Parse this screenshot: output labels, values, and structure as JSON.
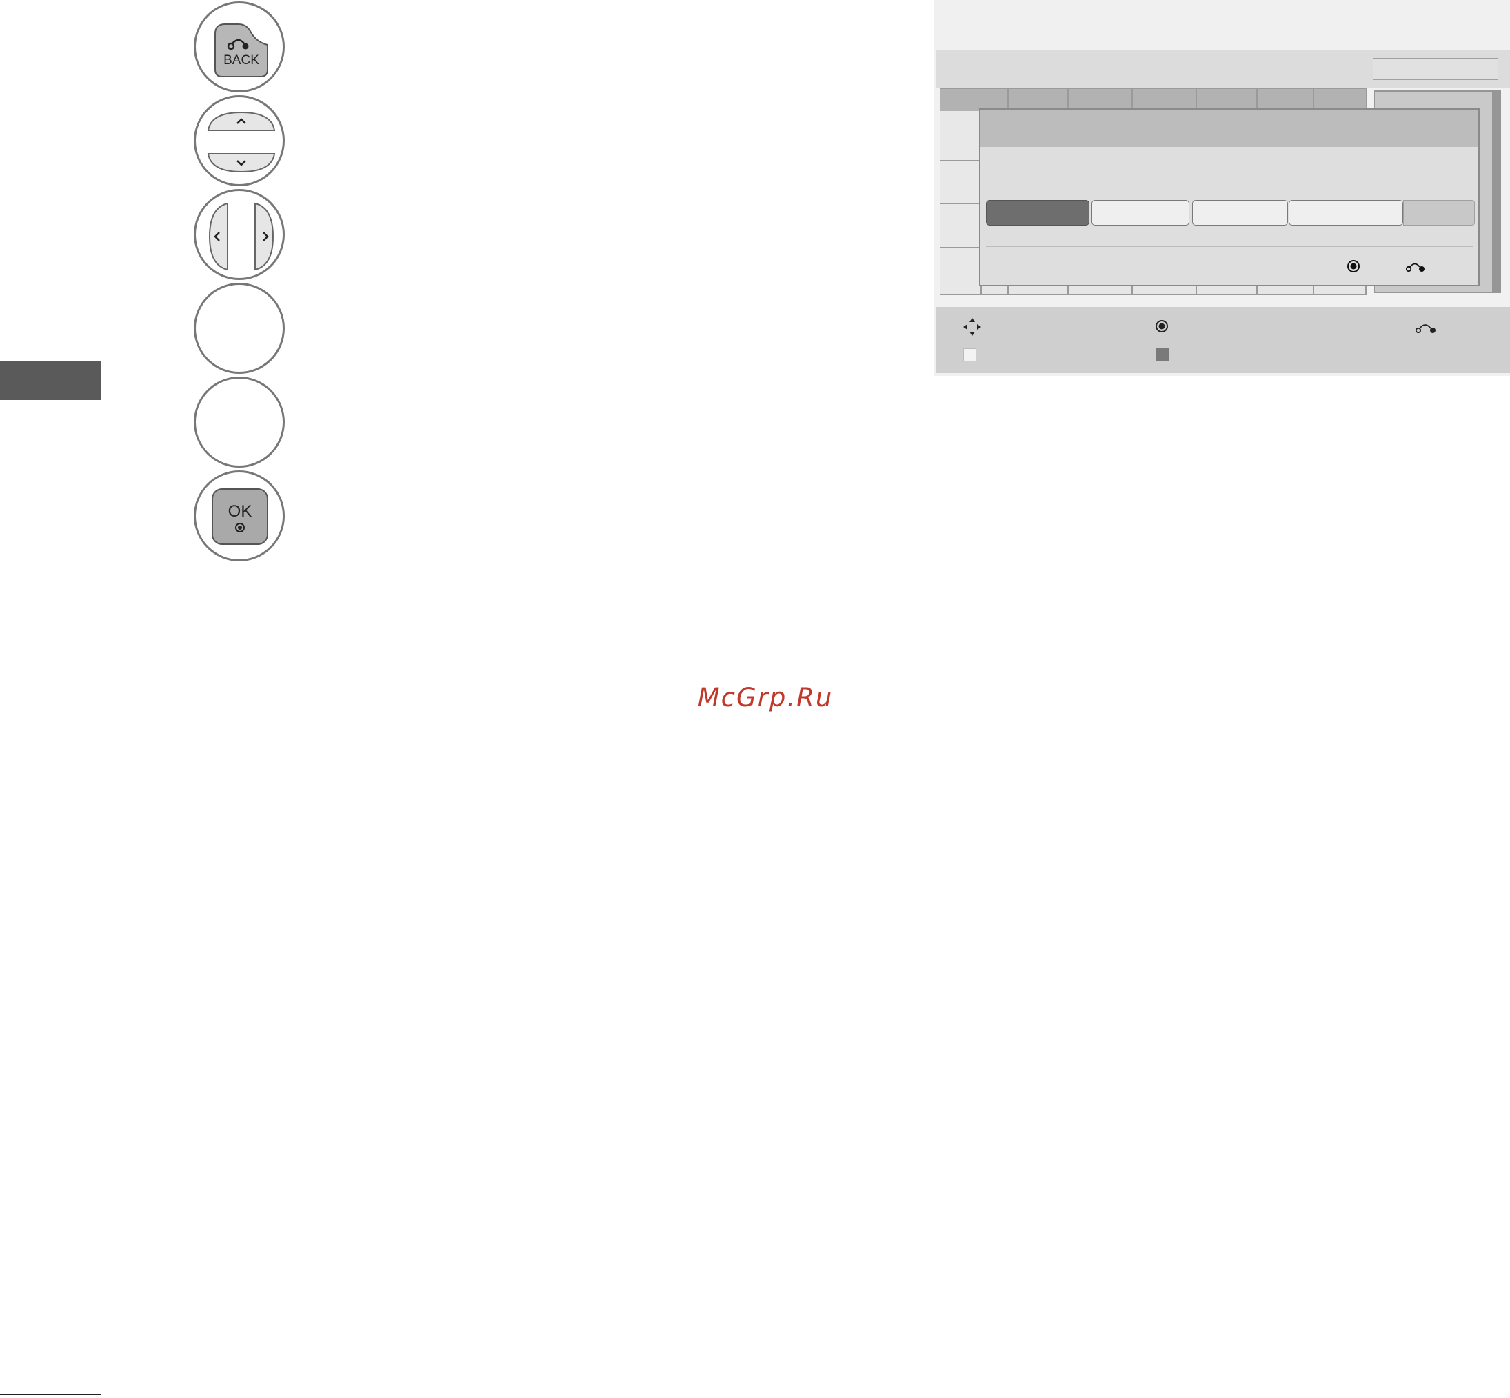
{
  "page": {
    "watermark": "McGrp.Ru"
  },
  "remote_keys": {
    "back_label": "BACK",
    "ok_label": "OK"
  },
  "colors": {
    "side_tab": "#5a5a5a",
    "watermark": "#c0392b",
    "dialog_selected_button": "#6e6e6e",
    "screen_bg": "#f1f1f1"
  }
}
